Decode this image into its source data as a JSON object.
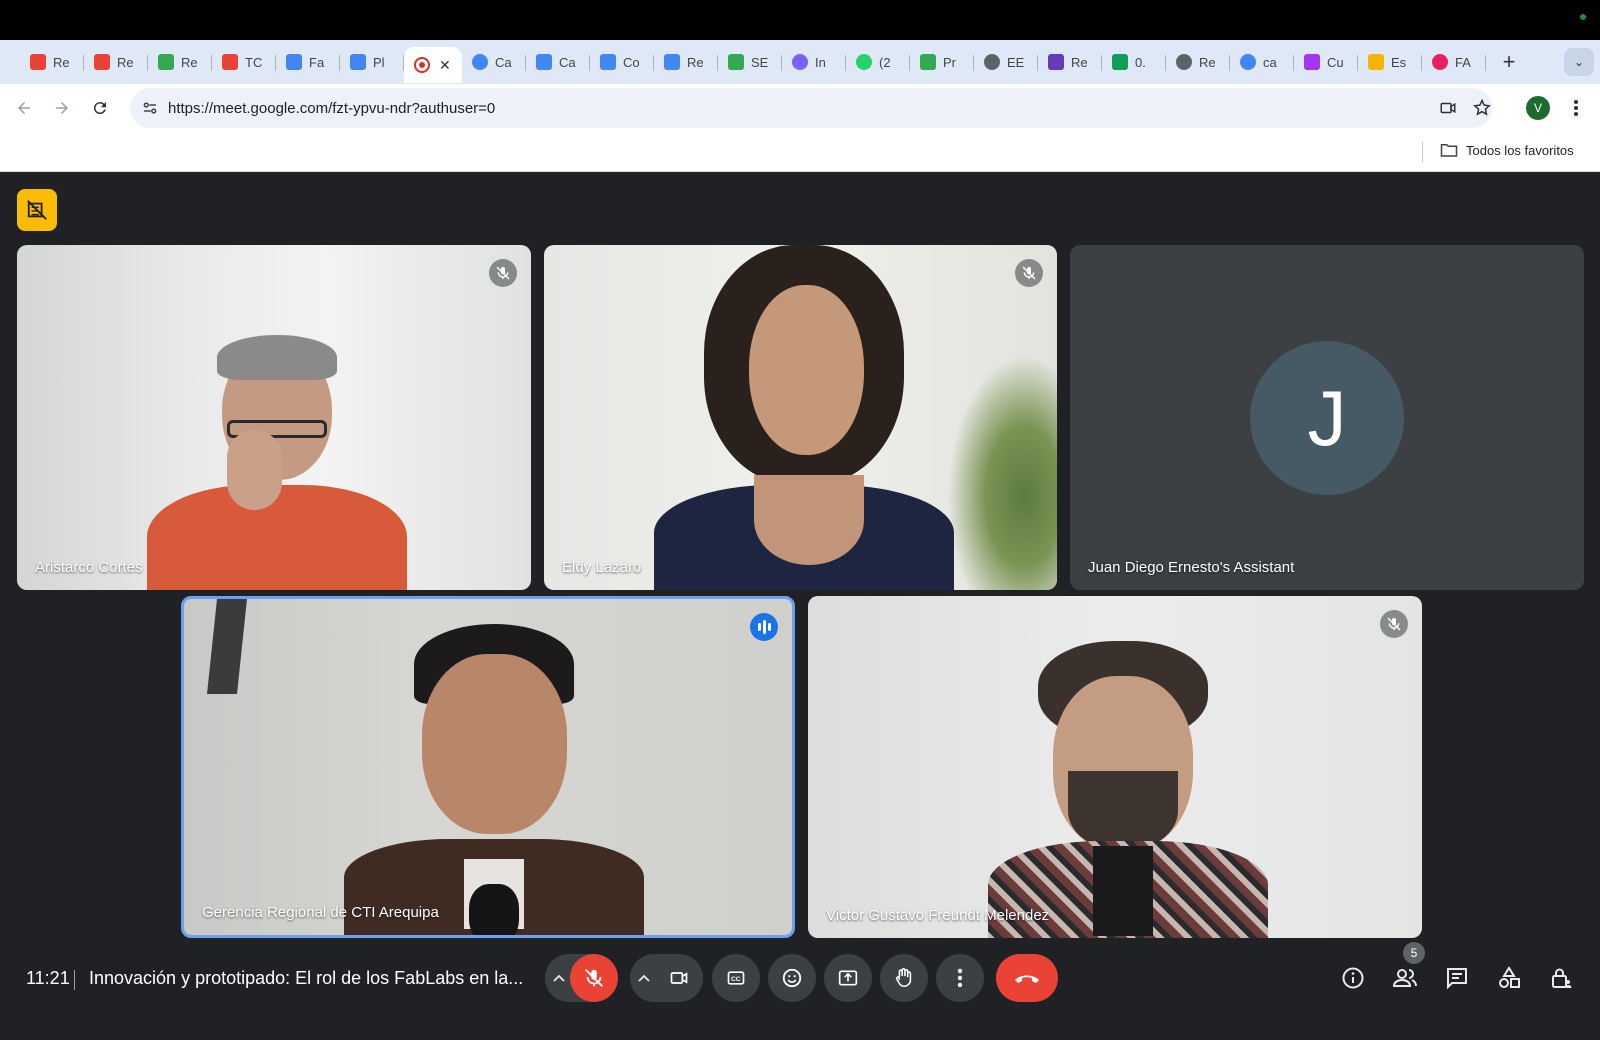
{
  "browser": {
    "tabs": [
      {
        "label": "Re",
        "icon": "gmail-icon",
        "color": "#ea4335"
      },
      {
        "label": "Re",
        "icon": "gmail-icon",
        "color": "#ea4335"
      },
      {
        "label": "Re",
        "icon": "drive-icon",
        "color": "#34a853"
      },
      {
        "label": "TC",
        "icon": "gmail-icon",
        "color": "#ea4335"
      },
      {
        "label": "Fa",
        "icon": "calendar-icon",
        "color": "#4285f4"
      },
      {
        "label": "Pl",
        "icon": "calendar-icon",
        "color": "#4285f4"
      },
      {
        "label": "",
        "icon": "record-icon",
        "color": "#d93025",
        "active": true
      },
      {
        "label": "Ca",
        "icon": "google-icon",
        "color": "#4285f4"
      },
      {
        "label": "Ca",
        "icon": "docs-icon",
        "color": "#4285f4"
      },
      {
        "label": "Co",
        "icon": "docs-icon",
        "color": "#4285f4"
      },
      {
        "label": "Re",
        "icon": "docs-icon",
        "color": "#4285f4"
      },
      {
        "label": "SE",
        "icon": "drive-icon",
        "color": "#34a853"
      },
      {
        "label": "In",
        "icon": "copilot-icon",
        "color": "#7b61ff"
      },
      {
        "label": "(2",
        "icon": "whatsapp-icon",
        "color": "#25d366"
      },
      {
        "label": "Pr",
        "icon": "drive-icon",
        "color": "#34a853"
      },
      {
        "label": "EE",
        "icon": "globe-icon",
        "color": "#5f6368"
      },
      {
        "label": "Re",
        "icon": "forms-icon",
        "color": "#673ab7"
      },
      {
        "label": "0.",
        "icon": "sheets-icon",
        "color": "#0f9d58"
      },
      {
        "label": "Re",
        "icon": "globe-icon",
        "color": "#5f6368"
      },
      {
        "label": "ca",
        "icon": "google-icon",
        "color": "#4285f4"
      },
      {
        "label": "Cu",
        "icon": "udemy-icon",
        "color": "#a435f0"
      },
      {
        "label": "Es",
        "icon": "slides-icon",
        "color": "#f4b400"
      },
      {
        "label": "FA",
        "icon": "fablab-icon",
        "color": "#e91e63"
      }
    ],
    "close_glyph": "✕",
    "new_tab_glyph": "+",
    "tab_menu_glyph": "⌄",
    "url": "https://meet.google.com/fzt-ypvu-ndr?authuser=0",
    "profile_initial": "V",
    "bookmarks_folder": "Todos los favoritos"
  },
  "meet": {
    "participants": [
      {
        "name": "Aristarco Cortes",
        "muted": true
      },
      {
        "name": "Eldy Lazaro",
        "muted": true
      },
      {
        "name": "Juan Diego Ernesto's Assistant",
        "avatar_initial": "J"
      },
      {
        "name": "Gerencia Regional de CTI Arequipa",
        "speaking": true
      },
      {
        "name": "Victor Gustavo Freundt Melendez",
        "muted": true
      }
    ],
    "time": "11:21",
    "meeting_title": "Innovación y prototipado: El rol de los FabLabs en la...",
    "participant_count": "5",
    "colors": {
      "bg": "#202124",
      "tile": "#3c4043",
      "danger": "#ea4335",
      "speaking": "#1a73e8",
      "yellow": "#fbbc04"
    }
  }
}
